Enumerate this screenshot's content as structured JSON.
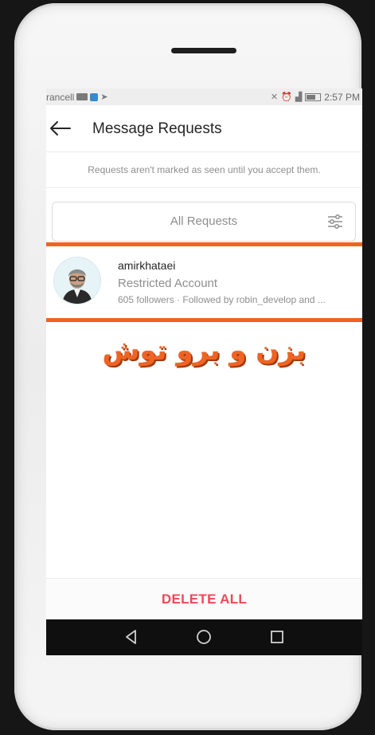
{
  "status_bar": {
    "carrier": "rancell",
    "time": "2:57 PM"
  },
  "header": {
    "title": "Message Requests"
  },
  "notice": "Requests aren't marked as seen until you accept them.",
  "filter": {
    "label": "All Requests"
  },
  "request": {
    "username": "amirkhataei",
    "subtitle": "Restricted Account",
    "followers": "605 followers · Followed by robin_develop and ..."
  },
  "overlay_text": "بزن و برو توش",
  "footer": {
    "delete_all": "DELETE ALL"
  },
  "colors": {
    "accent_orange": "#f06322",
    "delete_red": "#ed4956",
    "navbar": "#0f0f0f"
  },
  "icons": [
    "back-arrow-icon",
    "filter-sliders-icon",
    "nav-back-icon",
    "nav-home-icon",
    "nav-recents-icon",
    "signal-icon",
    "wifi-icon",
    "battery-icon",
    "alarm-icon"
  ]
}
